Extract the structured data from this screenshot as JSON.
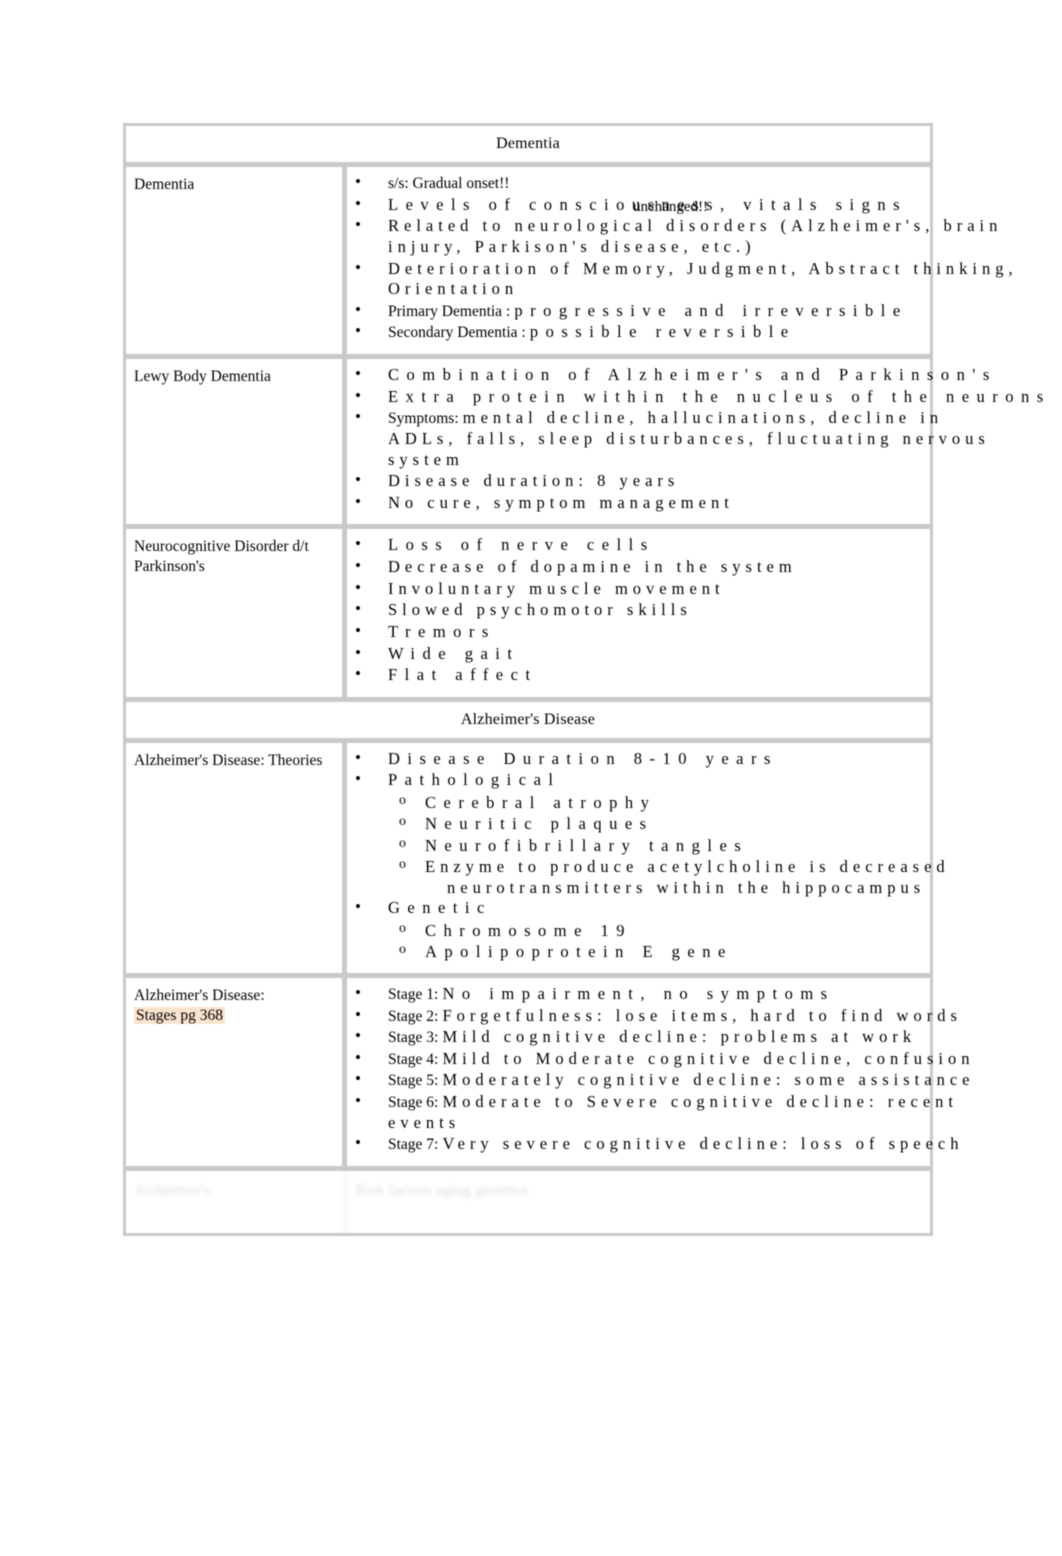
{
  "document": {
    "title": "Dementia",
    "page_background": "#ffffff",
    "border_color": "#c9c9c9",
    "highlight_color": "#fbe4cf"
  },
  "sections": [
    {
      "banner": "Dementia",
      "rows": [
        {
          "label": "Dementia",
          "bullets": [
            {
              "lead": "s/s: Gradual onset!!",
              "lead_tight": true,
              "rest": "",
              "overlay": ""
            },
            {
              "lead": "",
              "rest": "Levels of consciousness, vitals signs",
              "overlay": "unchanged!!"
            },
            {
              "lead": "",
              "rest": "Related to neurological disorders (Alzheimer's, brain",
              "cont": "injury, Parkison's disease, etc.)"
            },
            {
              "lead": "",
              "rest": "Deterioration of Memory, Judgment, Abstract thinking,",
              "cont": "Orientation"
            },
            {
              "lead": "Primary Dementia :",
              "lead_tight": true,
              "rest": "progressive and irreversible"
            },
            {
              "lead": "Secondary Dementia :",
              "lead_tight": true,
              "rest": "possible reversible"
            }
          ]
        },
        {
          "label": "Lewy Body Dementia",
          "bullets": [
            {
              "lead": "",
              "rest": "Combination of Alzheimer's and Parkinson's"
            },
            {
              "lead": "",
              "rest": "Extra protein within the nucleus of the neurons"
            },
            {
              "lead": "Symptoms:",
              "lead_tight": true,
              "rest": "mental decline, hallucinations, decline in",
              "cont": "ADLs, falls, sleep disturbances, fluctuating nervous",
              "cont2": "system"
            },
            {
              "lead": "",
              "rest": "Disease duration: 8 years"
            },
            {
              "lead": "",
              "rest": "No cure, symptom management"
            }
          ]
        },
        {
          "label": "Neurocognitive Disorder d/t Parkinson's",
          "bullets": [
            {
              "lead": "",
              "rest": "Loss of nerve cells"
            },
            {
              "lead": "",
              "rest": "Decrease of dopamine in the system"
            },
            {
              "lead": "",
              "rest": "Involuntary muscle movement"
            },
            {
              "lead": "",
              "rest": "Slowed psychomotor skills"
            },
            {
              "lead": "",
              "rest": "Tremors"
            },
            {
              "lead": "",
              "rest": "Wide gait"
            },
            {
              "lead": "",
              "rest": "Flat affect"
            }
          ]
        }
      ]
    },
    {
      "banner": "Alzheimer's Disease",
      "rows": [
        {
          "label": "Alzheimer's Disease: Theories",
          "bullets": [
            {
              "lead": "",
              "rest": "Disease Duration 8-10 years"
            },
            {
              "lead": "",
              "rest": "Pathological"
            }
          ],
          "sub_a": [
            "Cerebral atrophy",
            "Neuritic plaques",
            "Neurofibrillary tangles",
            "Enzyme to produce acetylcholine is decreased"
          ],
          "sub_a_cont": "neurotransmitters within the hippocampus",
          "bullet_b": "Genetic",
          "sub_b": [
            "Chromosome 19",
            "Apolipoprotein E gene"
          ]
        },
        {
          "label_line1": "Alzheimer's Disease:",
          "label_line2": "Stages pg 368",
          "label_line2_highlighted": true,
          "stages": [
            {
              "lead": "Stage 1:",
              "rest": "No impairment, no symptoms"
            },
            {
              "lead": "Stage 2:",
              "rest": "Forgetfulness: lose items, hard to find words"
            },
            {
              "lead": "Stage 3:",
              "rest": "Mild cognitive decline: problems at work"
            },
            {
              "lead": "Stage 4:",
              "rest": "Mild to Moderate cognitive decline, confusion"
            },
            {
              "lead": "Stage 5:",
              "rest": "Moderately cognitive decline: some assistance"
            },
            {
              "lead": "Stage 6:",
              "rest": "Moderate to Severe cognitive decline: recent",
              "cont": "events"
            },
            {
              "lead": "Stage 7:",
              "rest": "Very severe cognitive decline: loss of speech"
            }
          ]
        }
      ]
    }
  ],
  "faded_bottom_row": {
    "note": "illegible faded row",
    "left_ghost": "Alzheimer's",
    "right_ghost": "Risk factors aging genetics"
  }
}
